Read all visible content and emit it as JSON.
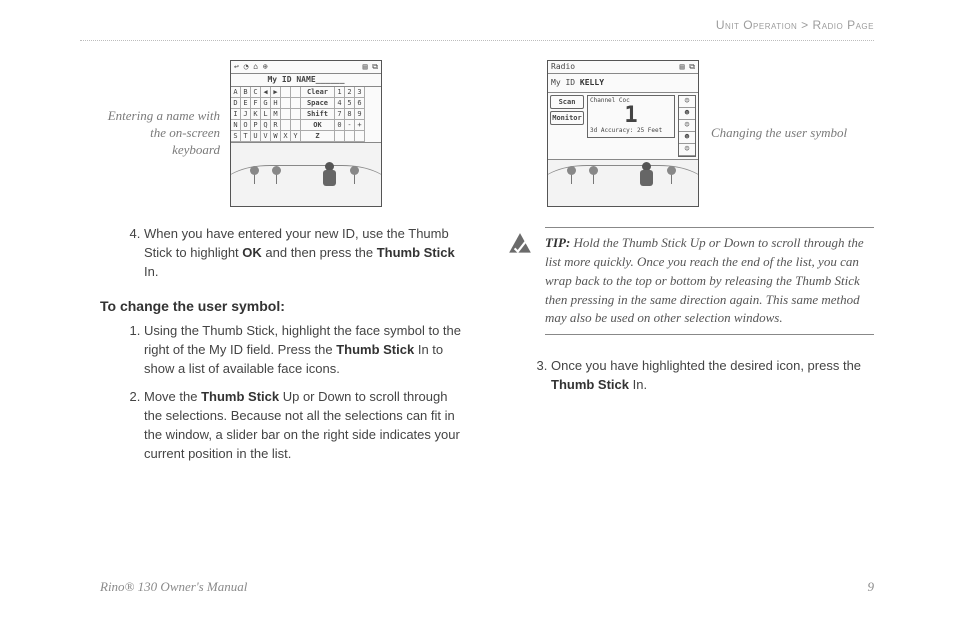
{
  "breadcrumb": {
    "section": "Unit Operation",
    "sep": " > ",
    "page": "Radio Page"
  },
  "left": {
    "figCaption": "Entering a name with the on-screen keyboard",
    "device": {
      "topIcons": "↩ ◔ ⌂ ⊕",
      "topRight": "▤ ⧉",
      "title": "My ID  NAME______",
      "keys": [
        "A",
        "B",
        "C",
        "◀",
        "▶",
        "",
        "",
        "Clear",
        "1",
        "2",
        "3",
        "D",
        "E",
        "F",
        "G",
        "H",
        "",
        "",
        "Space",
        "4",
        "5",
        "6",
        "I",
        "J",
        "K",
        "L",
        "M",
        "",
        "",
        "Shift",
        "7",
        "8",
        "9",
        "N",
        "O",
        "P",
        "Q",
        "R",
        "",
        "",
        "OK",
        "0",
        "-",
        "+",
        "S",
        "T",
        "U",
        "V",
        "W",
        "X",
        "Y",
        "Z",
        "",
        "",
        ""
      ]
    },
    "step4_a": "When you have entered your new ID, use the Thumb Stick to highlight ",
    "step4_b": "OK",
    "step4_c": " and then press the ",
    "step4_d": "Thumb Stick",
    "step4_e": " In.",
    "heading": "To change the user symbol:",
    "s1_a": "Using the Thumb Stick, highlight the face symbol to the right of the My ID field. Press the ",
    "s1_b": "Thumb Stick",
    "s1_c": " In to show a list of available face icons.",
    "s2_a": "Move the ",
    "s2_b": "Thumb Stick",
    "s2_c": " Up or Down to scroll through the selections. Because not all the selections can fit in the window, a slider bar on the right side indicates your current position in the list."
  },
  "right": {
    "figCaption": "Changing the user symbol",
    "radio": {
      "title": "Radio",
      "idLabel": "My ID",
      "idValue": "KELLY",
      "scan": "Scan",
      "monitor": "Monitor",
      "chLabel": "Channel    Coc",
      "chNum": "1",
      "accuracy": "3d Accuracy: 25 Feet"
    },
    "tipLabel": "TIP:",
    "tipBody": " Hold the Thumb Stick Up or Down to scroll through the list more quickly. Once you reach the end of the list, you can wrap back to the top or bottom by releasing the Thumb Stick then pressing in the same direction again. This same method may also be used on other selection windows.",
    "s3_a": "Once you have highlighted the desired icon, press the ",
    "s3_b": "Thumb Stick",
    "s3_c": " In."
  },
  "footer": {
    "left": "Rino® 130 Owner's Manual",
    "right": "9"
  }
}
